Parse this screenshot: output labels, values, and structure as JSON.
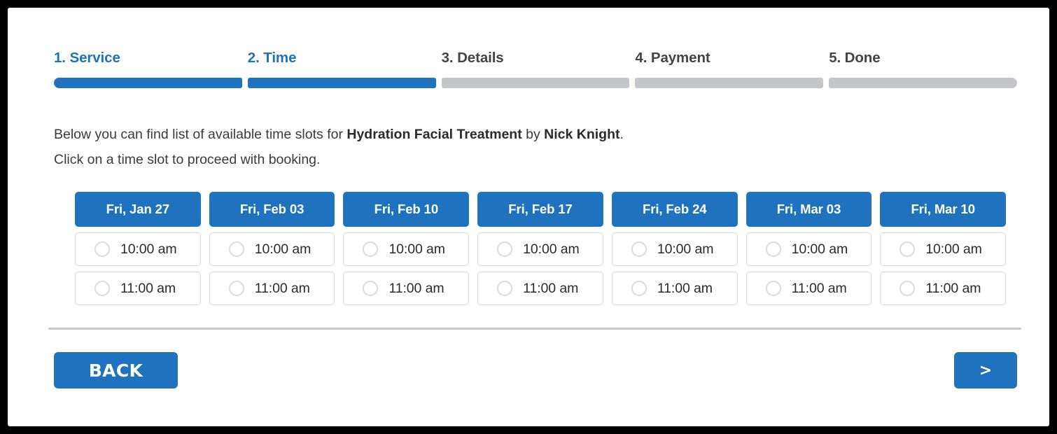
{
  "steps": [
    {
      "label": "1. Service",
      "state": "active"
    },
    {
      "label": "2. Time",
      "state": "active"
    },
    {
      "label": "3. Details",
      "state": "inactive"
    },
    {
      "label": "4. Payment",
      "state": "inactive"
    },
    {
      "label": "5. Done",
      "state": "inactive"
    }
  ],
  "intro": {
    "line1_prefix": "Below you can find list of available time slots for ",
    "service_name": "Hydration Facial Treatment",
    "line1_middle": " by ",
    "provider_name": "Nick Knight",
    "line1_suffix": ".",
    "line2": "Click on a time slot to proceed with booking."
  },
  "slots": {
    "columns": [
      {
        "date": "Fri, Jan 27",
        "times": [
          "10:00 am",
          "11:00 am"
        ]
      },
      {
        "date": "Fri, Feb 03",
        "times": [
          "10:00 am",
          "11:00 am"
        ]
      },
      {
        "date": "Fri, Feb 10",
        "times": [
          "10:00 am",
          "11:00 am"
        ]
      },
      {
        "date": "Fri, Feb 17",
        "times": [
          "10:00 am",
          "11:00 am"
        ]
      },
      {
        "date": "Fri, Feb 24",
        "times": [
          "10:00 am",
          "11:00 am"
        ]
      },
      {
        "date": "Fri, Mar 03",
        "times": [
          "10:00 am",
          "11:00 am"
        ]
      },
      {
        "date": "Fri, Mar 10",
        "times": [
          "10:00 am",
          "11:00 am"
        ]
      }
    ]
  },
  "footer": {
    "back_label": "BACK",
    "next_label": ">"
  },
  "colors": {
    "accent": "#1f72bd",
    "accent_text": "#1b72bd",
    "inactive_bar": "#c3c7cb",
    "inactive_label": "#444447",
    "slot_border": "#dcdcde",
    "divider": "#c6c8cb",
    "frame": "#000000"
  }
}
